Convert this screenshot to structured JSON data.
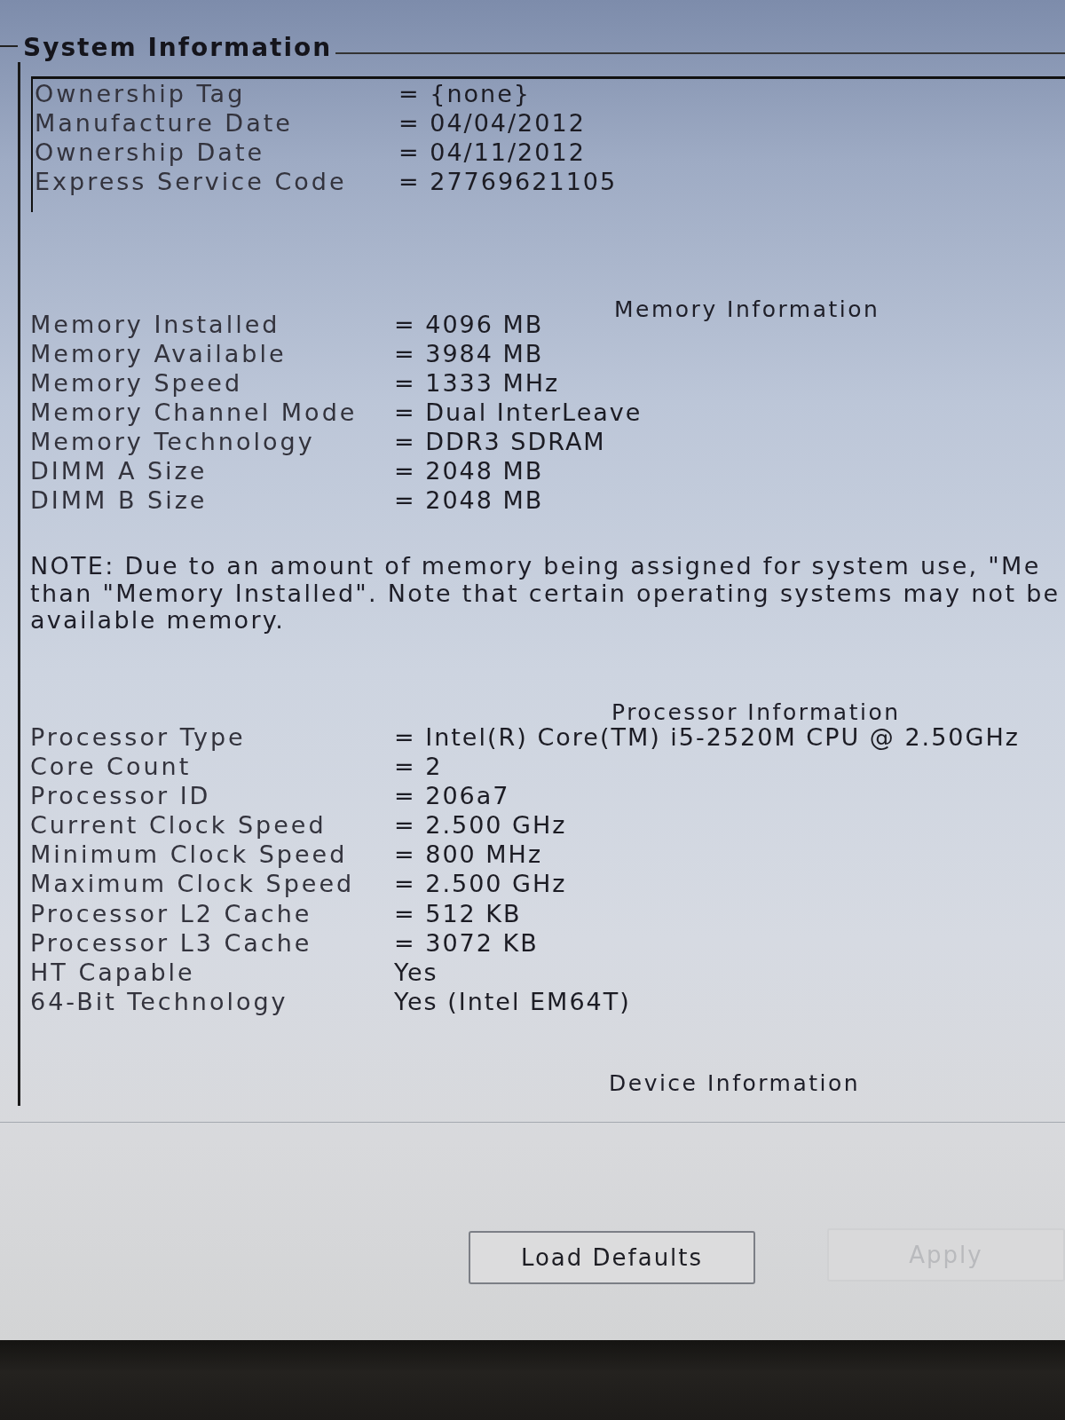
{
  "section": {
    "title": "System Information"
  },
  "system_rows": [
    {
      "label": "Ownership Tag",
      "value": "= {none}"
    },
    {
      "label": "Manufacture Date",
      "value": "= 04/04/2012"
    },
    {
      "label": "Ownership Date",
      "value": "= 04/11/2012"
    },
    {
      "label": "Express Service Code",
      "value": "= 27769621105"
    }
  ],
  "memory": {
    "heading": "Memory Information",
    "rows": [
      {
        "label": "Memory Installed",
        "value": "= 4096 MB"
      },
      {
        "label": "Memory Available",
        "value": "= 3984 MB"
      },
      {
        "label": "Memory Speed",
        "value": "= 1333 MHz"
      },
      {
        "label": "Memory Channel Mode",
        "value": "= Dual InterLeave"
      },
      {
        "label": "Memory Technology",
        "value": "= DDR3 SDRAM"
      },
      {
        "label": "DIMM A Size",
        "value": "= 2048 MB"
      },
      {
        "label": "DIMM B Size",
        "value": "= 2048 MB"
      }
    ]
  },
  "note_lines": [
    "NOTE: Due to an amount of memory being assigned for system use, \"Me",
    "than \"Memory Installed\". Note that certain operating systems may not be",
    "available memory."
  ],
  "processor": {
    "heading": "Processor Information",
    "rows": [
      {
        "label": "Processor Type",
        "value": "= Intel(R) Core(TM) i5-2520M CPU @ 2.50GHz"
      },
      {
        "label": "Core Count",
        "value": "= 2"
      },
      {
        "label": "Processor ID",
        "value": "= 206a7"
      },
      {
        "label": "Current Clock Speed",
        "value": "= 2.500 GHz"
      },
      {
        "label": "Minimum Clock Speed",
        "value": "= 800 MHz"
      },
      {
        "label": "Maximum Clock Speed",
        "value": "= 2.500 GHz"
      },
      {
        "label": "Processor L2 Cache",
        "value": "= 512 KB"
      },
      {
        "label": "Processor L3 Cache",
        "value": "= 3072 KB"
      },
      {
        "label": "HT Capable",
        "value": "Yes"
      },
      {
        "label": "64-Bit Technology",
        "value": "Yes (Intel EM64T)"
      }
    ]
  },
  "device": {
    "heading": "Device Information"
  },
  "buttons": [
    {
      "label": "Load Defaults",
      "disabled": false
    },
    {
      "label": "Apply",
      "disabled": true
    }
  ]
}
